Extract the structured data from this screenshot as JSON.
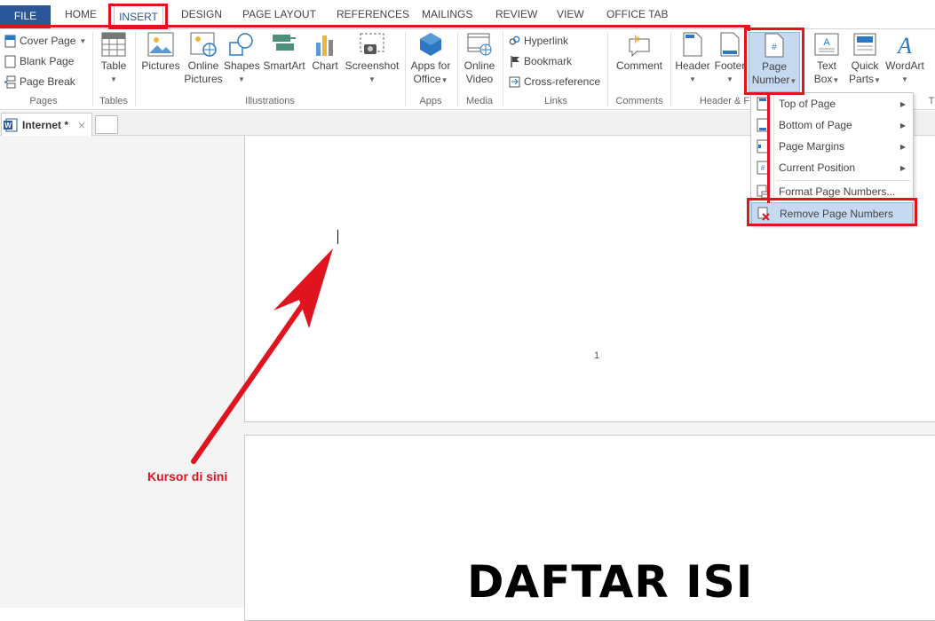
{
  "tabs": {
    "file": "FILE",
    "home": "HOME",
    "insert": "INSERT",
    "design": "DESIGN",
    "page_layout": "PAGE LAYOUT",
    "references": "REFERENCES",
    "mailings": "MAILINGS",
    "review": "REVIEW",
    "view": "VIEW",
    "office_tab": "OFFICE TAB"
  },
  "ribbon": {
    "pages": {
      "cover_page": "Cover Page",
      "blank_page": "Blank Page",
      "page_break": "Page Break",
      "group": "Pages"
    },
    "tables": {
      "table": "Table",
      "group": "Tables"
    },
    "illustrations": {
      "pictures": "Pictures",
      "online_pictures_1": "Online",
      "online_pictures_2": "Pictures",
      "shapes": "Shapes",
      "smartart": "SmartArt",
      "chart": "Chart",
      "screenshot": "Screenshot",
      "group": "Illustrations"
    },
    "apps": {
      "apps_1": "Apps for",
      "apps_2": "Office",
      "group": "Apps"
    },
    "media": {
      "video_1": "Online",
      "video_2": "Video",
      "group": "Media"
    },
    "links": {
      "hyperlink": "Hyperlink",
      "bookmark": "Bookmark",
      "cross_reference": "Cross-reference",
      "group": "Links"
    },
    "comments": {
      "comment": "Comment",
      "group": "Comments"
    },
    "header_footer": {
      "header": "Header",
      "footer": "Footer",
      "page_number_1": "Page",
      "page_number_2": "Number",
      "group": "Header & F"
    },
    "text": {
      "text_box_1": "Text",
      "text_box_2": "Box",
      "quick_parts_1": "Quick",
      "quick_parts_2": "Parts",
      "wordart": "WordArt",
      "group": "T"
    }
  },
  "document_tab": {
    "name": "Internet *",
    "close": "×"
  },
  "page_number_menu": {
    "items": [
      {
        "label": "Top of Page",
        "submenu": true
      },
      {
        "label": "Bottom of Page",
        "submenu": true
      },
      {
        "label": "Page Margins",
        "submenu": true
      },
      {
        "label": "Current Position",
        "submenu": true
      },
      {
        "label": "Format Page Numbers...",
        "submenu": false
      },
      {
        "label": "Remove Page Numbers",
        "submenu": false
      }
    ]
  },
  "document": {
    "page_number": "1",
    "heading": "DAFTAR ISI"
  },
  "annotation": {
    "text": "Kursor di sini"
  },
  "colors": {
    "file_tab": "#2b579a",
    "annotation_red": "#e0141e",
    "highlight": "#c5d9f1"
  }
}
